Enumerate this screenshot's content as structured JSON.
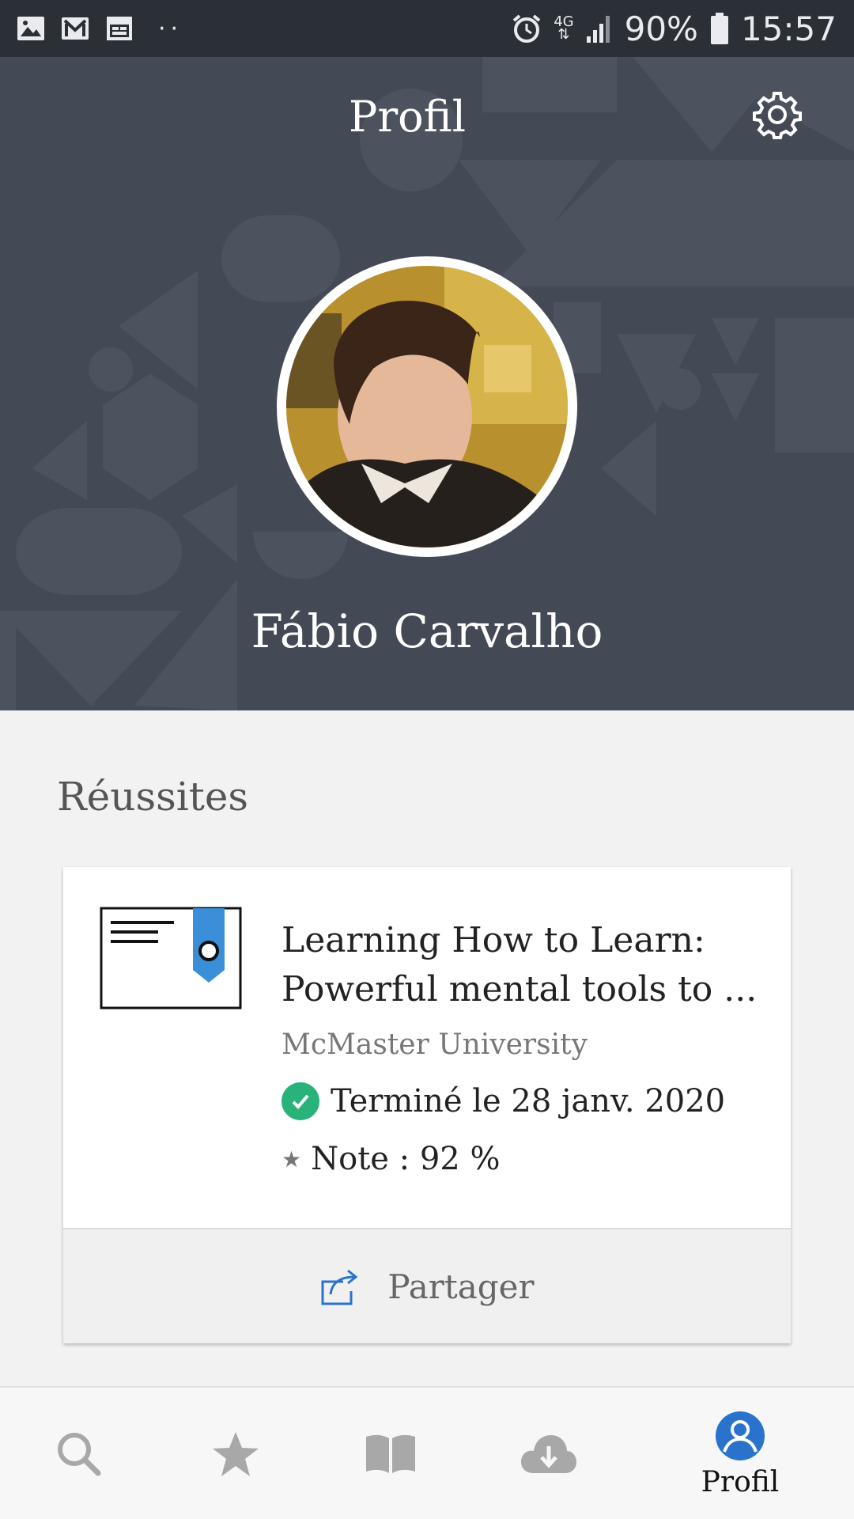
{
  "status_bar": {
    "left_icons": [
      "image-icon",
      "gmail-icon",
      "calendar-icon"
    ],
    "dots": "··",
    "network": "4G",
    "battery": "90%",
    "time": "15:57"
  },
  "header": {
    "title": "Profil",
    "background_color": "#444a55",
    "user_name": "Fábio Carvalho"
  },
  "achievements": {
    "section_title": "Réussites",
    "items": [
      {
        "title_line1": "Learning How to Learn:",
        "title_line2": "Powerful mental tools to ...",
        "partner": "McMaster University",
        "status": "Terminé le 28 janv. 2020",
        "grade": "Note : 92 %",
        "share_label": "Partager"
      }
    ]
  },
  "bottom_nav": {
    "items": [
      {
        "icon": "search-icon"
      },
      {
        "icon": "star-icon"
      },
      {
        "icon": "book-icon"
      },
      {
        "icon": "cloud-download-icon"
      },
      {
        "icon": "profile-icon",
        "label": "Profil",
        "active": true
      }
    ],
    "active_color": "#2a73cc"
  },
  "colors": {
    "success": "#2ab27b",
    "accent_blue": "#2a73cc"
  }
}
